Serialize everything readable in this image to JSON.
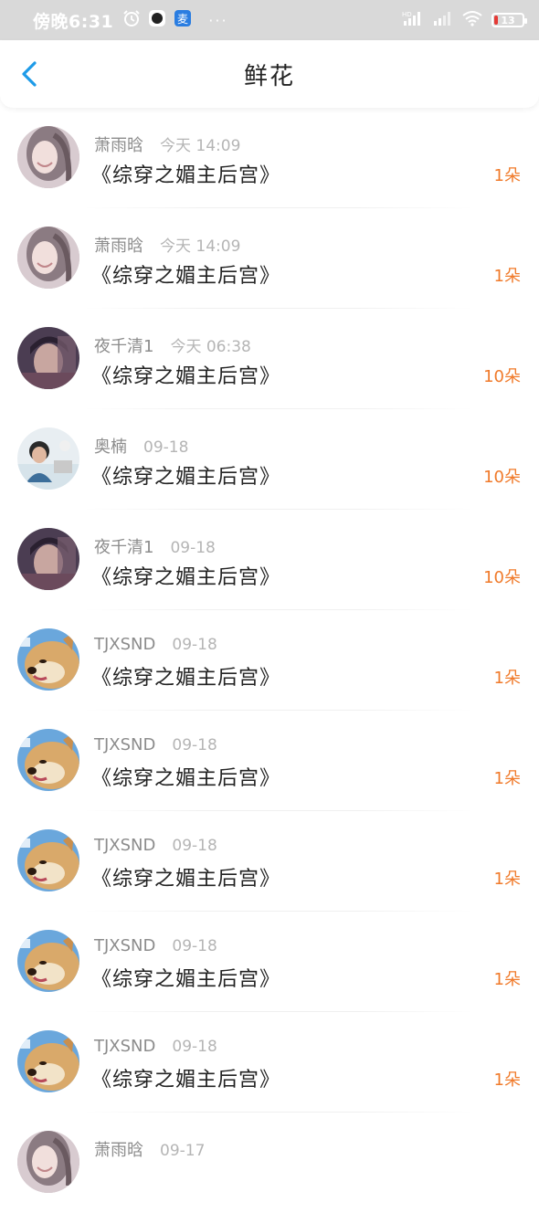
{
  "status_bar": {
    "time": "傍晚6:31",
    "dots": "···",
    "battery_level": "13",
    "battery_fraction": 0.13,
    "icons": [
      "alarm-icon",
      "camera-app-icon",
      "notification-app-icon",
      "hd-icon",
      "signal-icon",
      "signal-icon-2",
      "wifi-icon",
      "battery-icon"
    ]
  },
  "header": {
    "title": "鲜花",
    "back_icon": "chevron-left-icon",
    "accent_color": "#1e9be8"
  },
  "colors": {
    "count": "#f07a2a",
    "title_text": "#222222",
    "meta_text": "#9a9a9a"
  },
  "items": [
    {
      "user": "萧雨晗",
      "time": "今天 14:09",
      "title": "《综穿之媚主后宫》",
      "count": "1朵",
      "avatar": "girl-avatar"
    },
    {
      "user": "萧雨晗",
      "time": "今天 14:09",
      "title": "《综穿之媚主后宫》",
      "count": "1朵",
      "avatar": "girl-avatar"
    },
    {
      "user": "夜千清1",
      "time": "今天 06:38",
      "title": "《综穿之媚主后宫》",
      "count": "10朵",
      "avatar": "boy-avatar"
    },
    {
      "user": "奥楠",
      "time": "09-18",
      "title": "《综穿之媚主后宫》",
      "count": "10朵",
      "avatar": "woman-avatar"
    },
    {
      "user": "夜千清1",
      "time": "09-18",
      "title": "《综穿之媚主后宫》",
      "count": "10朵",
      "avatar": "boy-avatar"
    },
    {
      "user": "TJXSND",
      "time": "09-18",
      "title": "《综穿之媚主后宫》",
      "count": "1朵",
      "avatar": "dog-avatar"
    },
    {
      "user": "TJXSND",
      "time": "09-18",
      "title": "《综穿之媚主后宫》",
      "count": "1朵",
      "avatar": "dog-avatar"
    },
    {
      "user": "TJXSND",
      "time": "09-18",
      "title": "《综穿之媚主后宫》",
      "count": "1朵",
      "avatar": "dog-avatar"
    },
    {
      "user": "TJXSND",
      "time": "09-18",
      "title": "《综穿之媚主后宫》",
      "count": "1朵",
      "avatar": "dog-avatar"
    },
    {
      "user": "TJXSND",
      "time": "09-18",
      "title": "《综穿之媚主后宫》",
      "count": "1朵",
      "avatar": "dog-avatar"
    },
    {
      "user": "萧雨晗",
      "time": "09-17",
      "title": "",
      "count": "",
      "avatar": "girl-avatar"
    }
  ]
}
